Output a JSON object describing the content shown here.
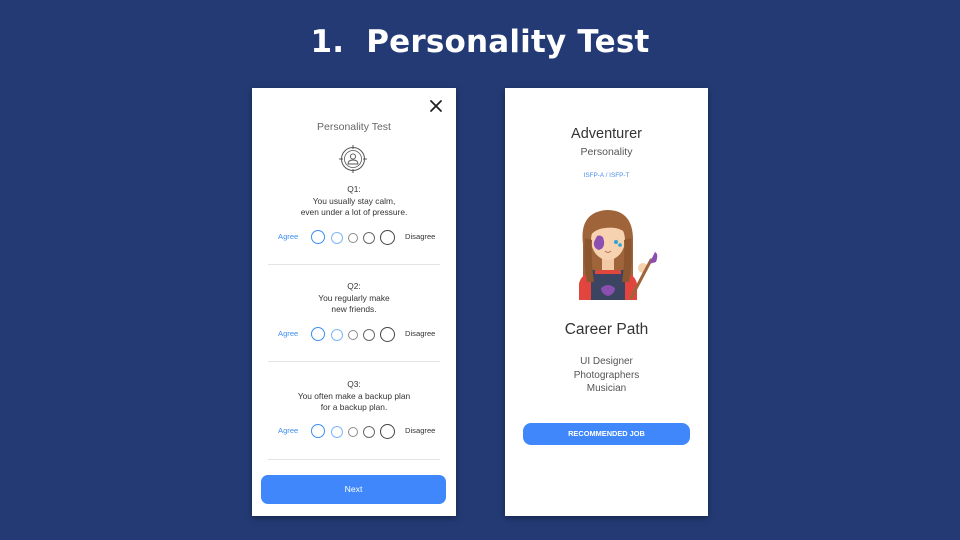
{
  "slide": {
    "number": "1.",
    "title": "Personality Test"
  },
  "test_screen": {
    "title": "Personality Test",
    "agree_label": "Agree",
    "disagree_label": "Disagree",
    "questions": [
      {
        "number": "Q1:",
        "text": "You usually stay calm,\neven under a lot of pressure."
      },
      {
        "number": "Q2:",
        "text": "You regularly make\nnew friends."
      },
      {
        "number": "Q3:",
        "text": "You often make a backup plan\nfor a backup plan."
      }
    ],
    "next_label": "Next",
    "icons": {
      "close": "close-icon",
      "header": "personality-target-icon"
    }
  },
  "result_screen": {
    "type_name": "Adventurer",
    "type_sub": "Personality",
    "type_code": "ISFP-A / ISFP-T",
    "career_title": "Career Path",
    "careers": [
      "UI Designer",
      "Photographers",
      "Musician"
    ],
    "button_label": "RECOMMENDED JOB",
    "icons": {
      "avatar": "painter-girl-avatar"
    }
  },
  "colors": {
    "background": "#233a74",
    "accent": "#3f87fb",
    "agree_text": "#3d8ef0"
  }
}
